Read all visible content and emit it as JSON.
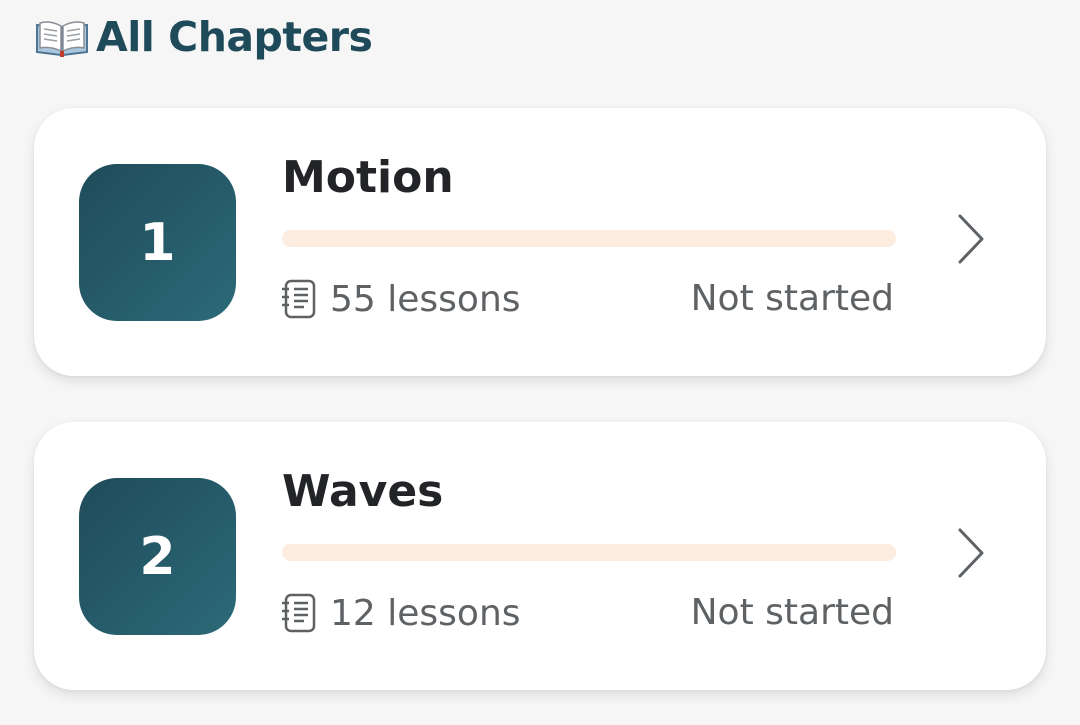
{
  "header": {
    "icon": "open-book-icon",
    "title": "All Chapters"
  },
  "colors": {
    "title": "#1f4a5a",
    "badge_start": "#1f4b59",
    "badge_end": "#2c6a78",
    "progress_track": "#fdece0",
    "text_muted": "#5f6265"
  },
  "chapters": [
    {
      "number": "1",
      "title": "Motion",
      "progress": 0,
      "lessons_icon": "lesson-list-icon",
      "lessons": "55 lessons",
      "status": "Not started",
      "chevron_icon": "chevron-right-icon"
    },
    {
      "number": "2",
      "title": "Waves",
      "progress": 0,
      "lessons_icon": "lesson-list-icon",
      "lessons": "12 lessons",
      "status": "Not started",
      "chevron_icon": "chevron-right-icon"
    }
  ]
}
